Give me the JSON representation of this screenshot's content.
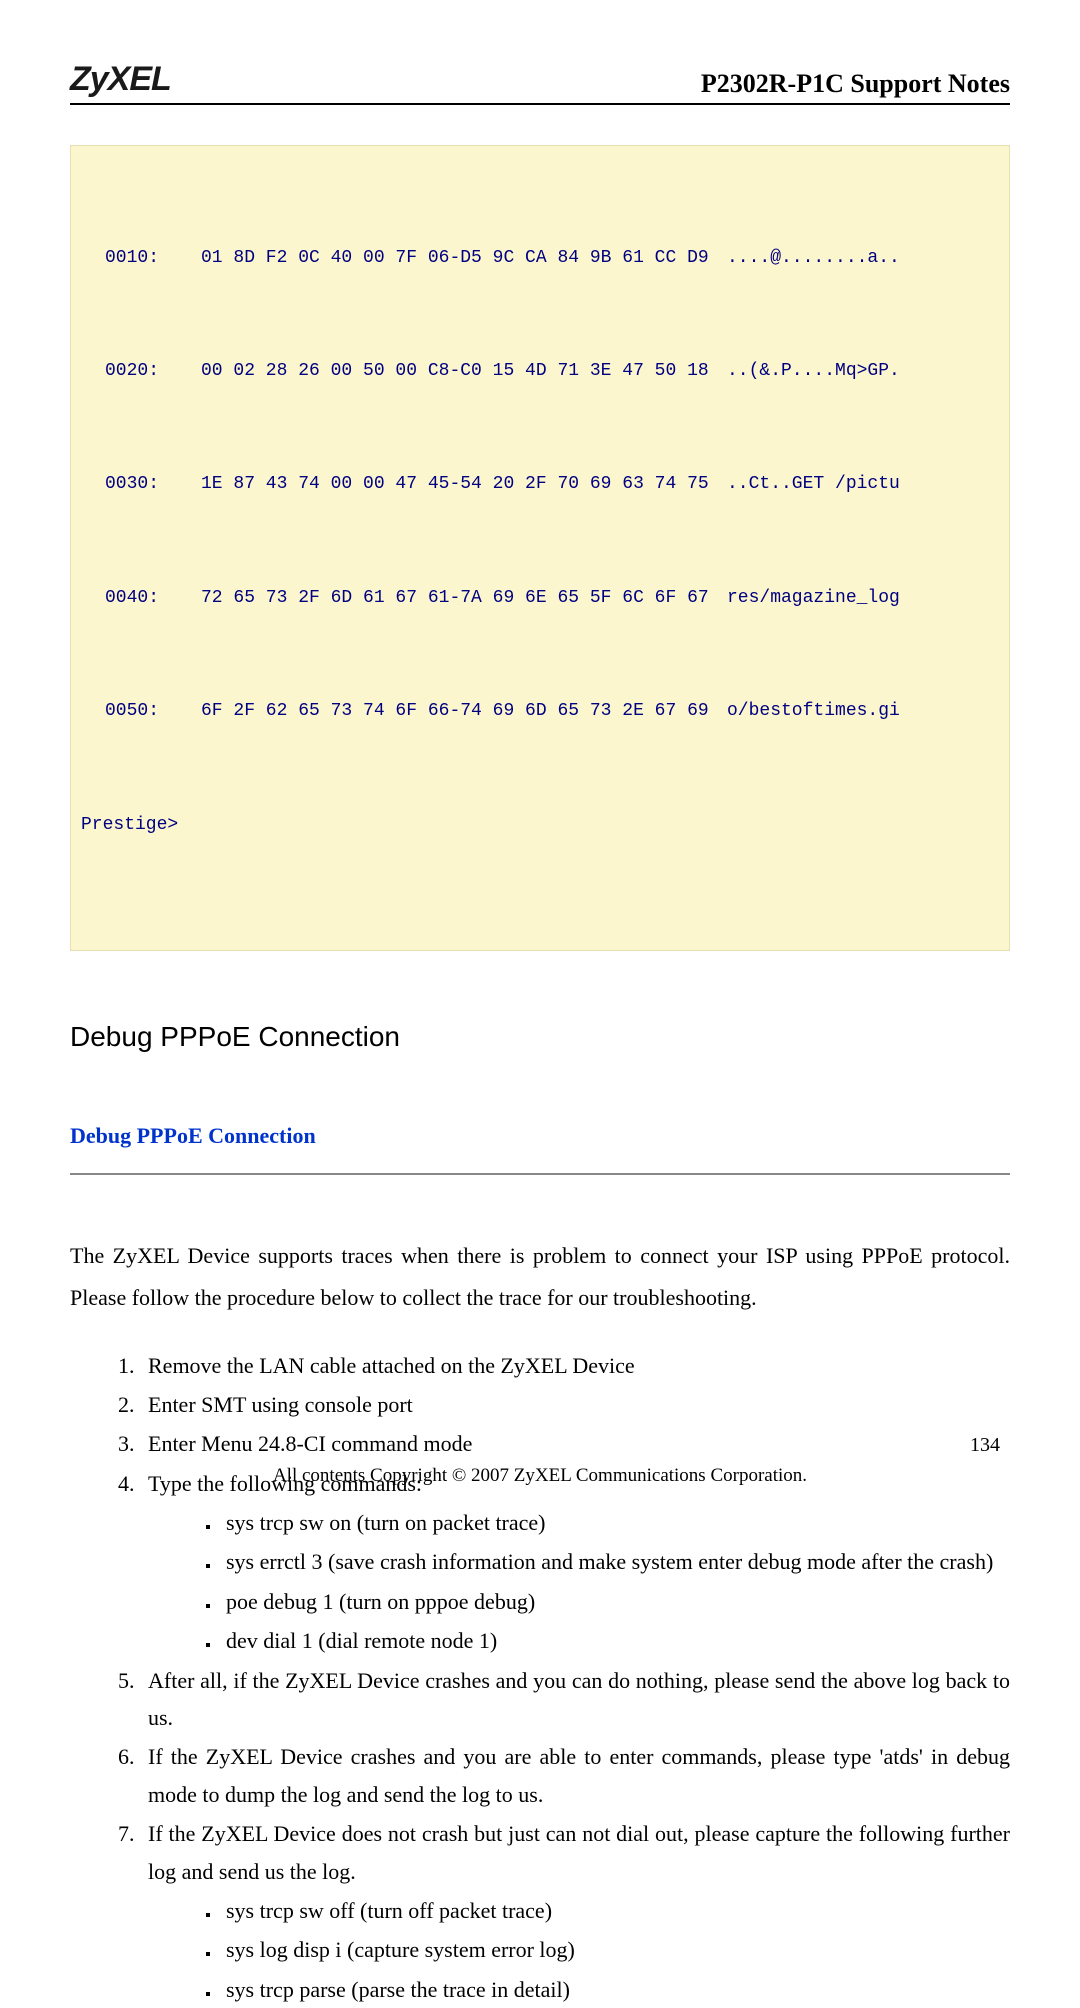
{
  "header": {
    "logo": "ZyXEL",
    "title": "P2302R-P1C Support Notes"
  },
  "code": {
    "rows": [
      {
        "offset": "0010:",
        "hex": "01 8D F2 0C 40 00 7F 06-D5 9C CA 84 9B 61 CC D9",
        "ascii": "....@........a.."
      },
      {
        "offset": "0020:",
        "hex": "00 02 28 26 00 50 00 C8-C0 15 4D 71 3E 47 50 18",
        "ascii": "..(&.P....Mq>GP."
      },
      {
        "offset": "0030:",
        "hex": "1E 87 43 74 00 00 47 45-54 20 2F 70 69 63 74 75",
        "ascii": "..Ct..GET /pictu"
      },
      {
        "offset": "0040:",
        "hex": "72 65 73 2F 6D 61 67 61-7A 69 6E 65 5F 6C 6F 67",
        "ascii": "res/magazine_log"
      },
      {
        "offset": "0050:",
        "hex": "6F 2F 62 65 73 74 6F 66-74 69 6D 65 73 2E 67 69",
        "ascii": "o/bestoftimes.gi"
      }
    ],
    "prompt": "Prestige>"
  },
  "section_title": "Debug PPPoE Connection",
  "sub_link": "Debug PPPoE Connection",
  "intro": "The ZyXEL Device supports traces when there is problem to connect your ISP using PPPoE protocol. Please follow the procedure below to collect the trace for our troubleshooting.",
  "steps": [
    "Remove the LAN cable attached on the ZyXEL Device",
    "Enter SMT using console port",
    "Enter Menu 24.8-CI command mode",
    "Type the following commands:",
    "After all, if the ZyXEL Device crashes and you can do nothing, please send the above log back to us.",
    "If the ZyXEL Device crashes and you are able to enter commands, please type 'atds' in debug mode to dump the log and send the log to us.",
    "If the ZyXEL Device does not crash but just can not dial out, please capture the following further log and send us the log."
  ],
  "sub4": [
    "sys trcp sw on   (turn on packet trace)",
    "sys errctl 3 (save crash information and make system enter debug mode after the crash)",
    "poe debug 1 (turn on pppoe debug)",
    "dev dial 1 (dial remote node 1)"
  ],
  "sub7": [
    "sys trcp sw off (turn off packet trace)",
    "sys log disp i (capture system error log)",
    "sys trcp parse (parse the trace in detail)"
  ],
  "footer": {
    "page": "134",
    "copyright": "All contents Copyright © 2007 ZyXEL Communications Corporation."
  }
}
